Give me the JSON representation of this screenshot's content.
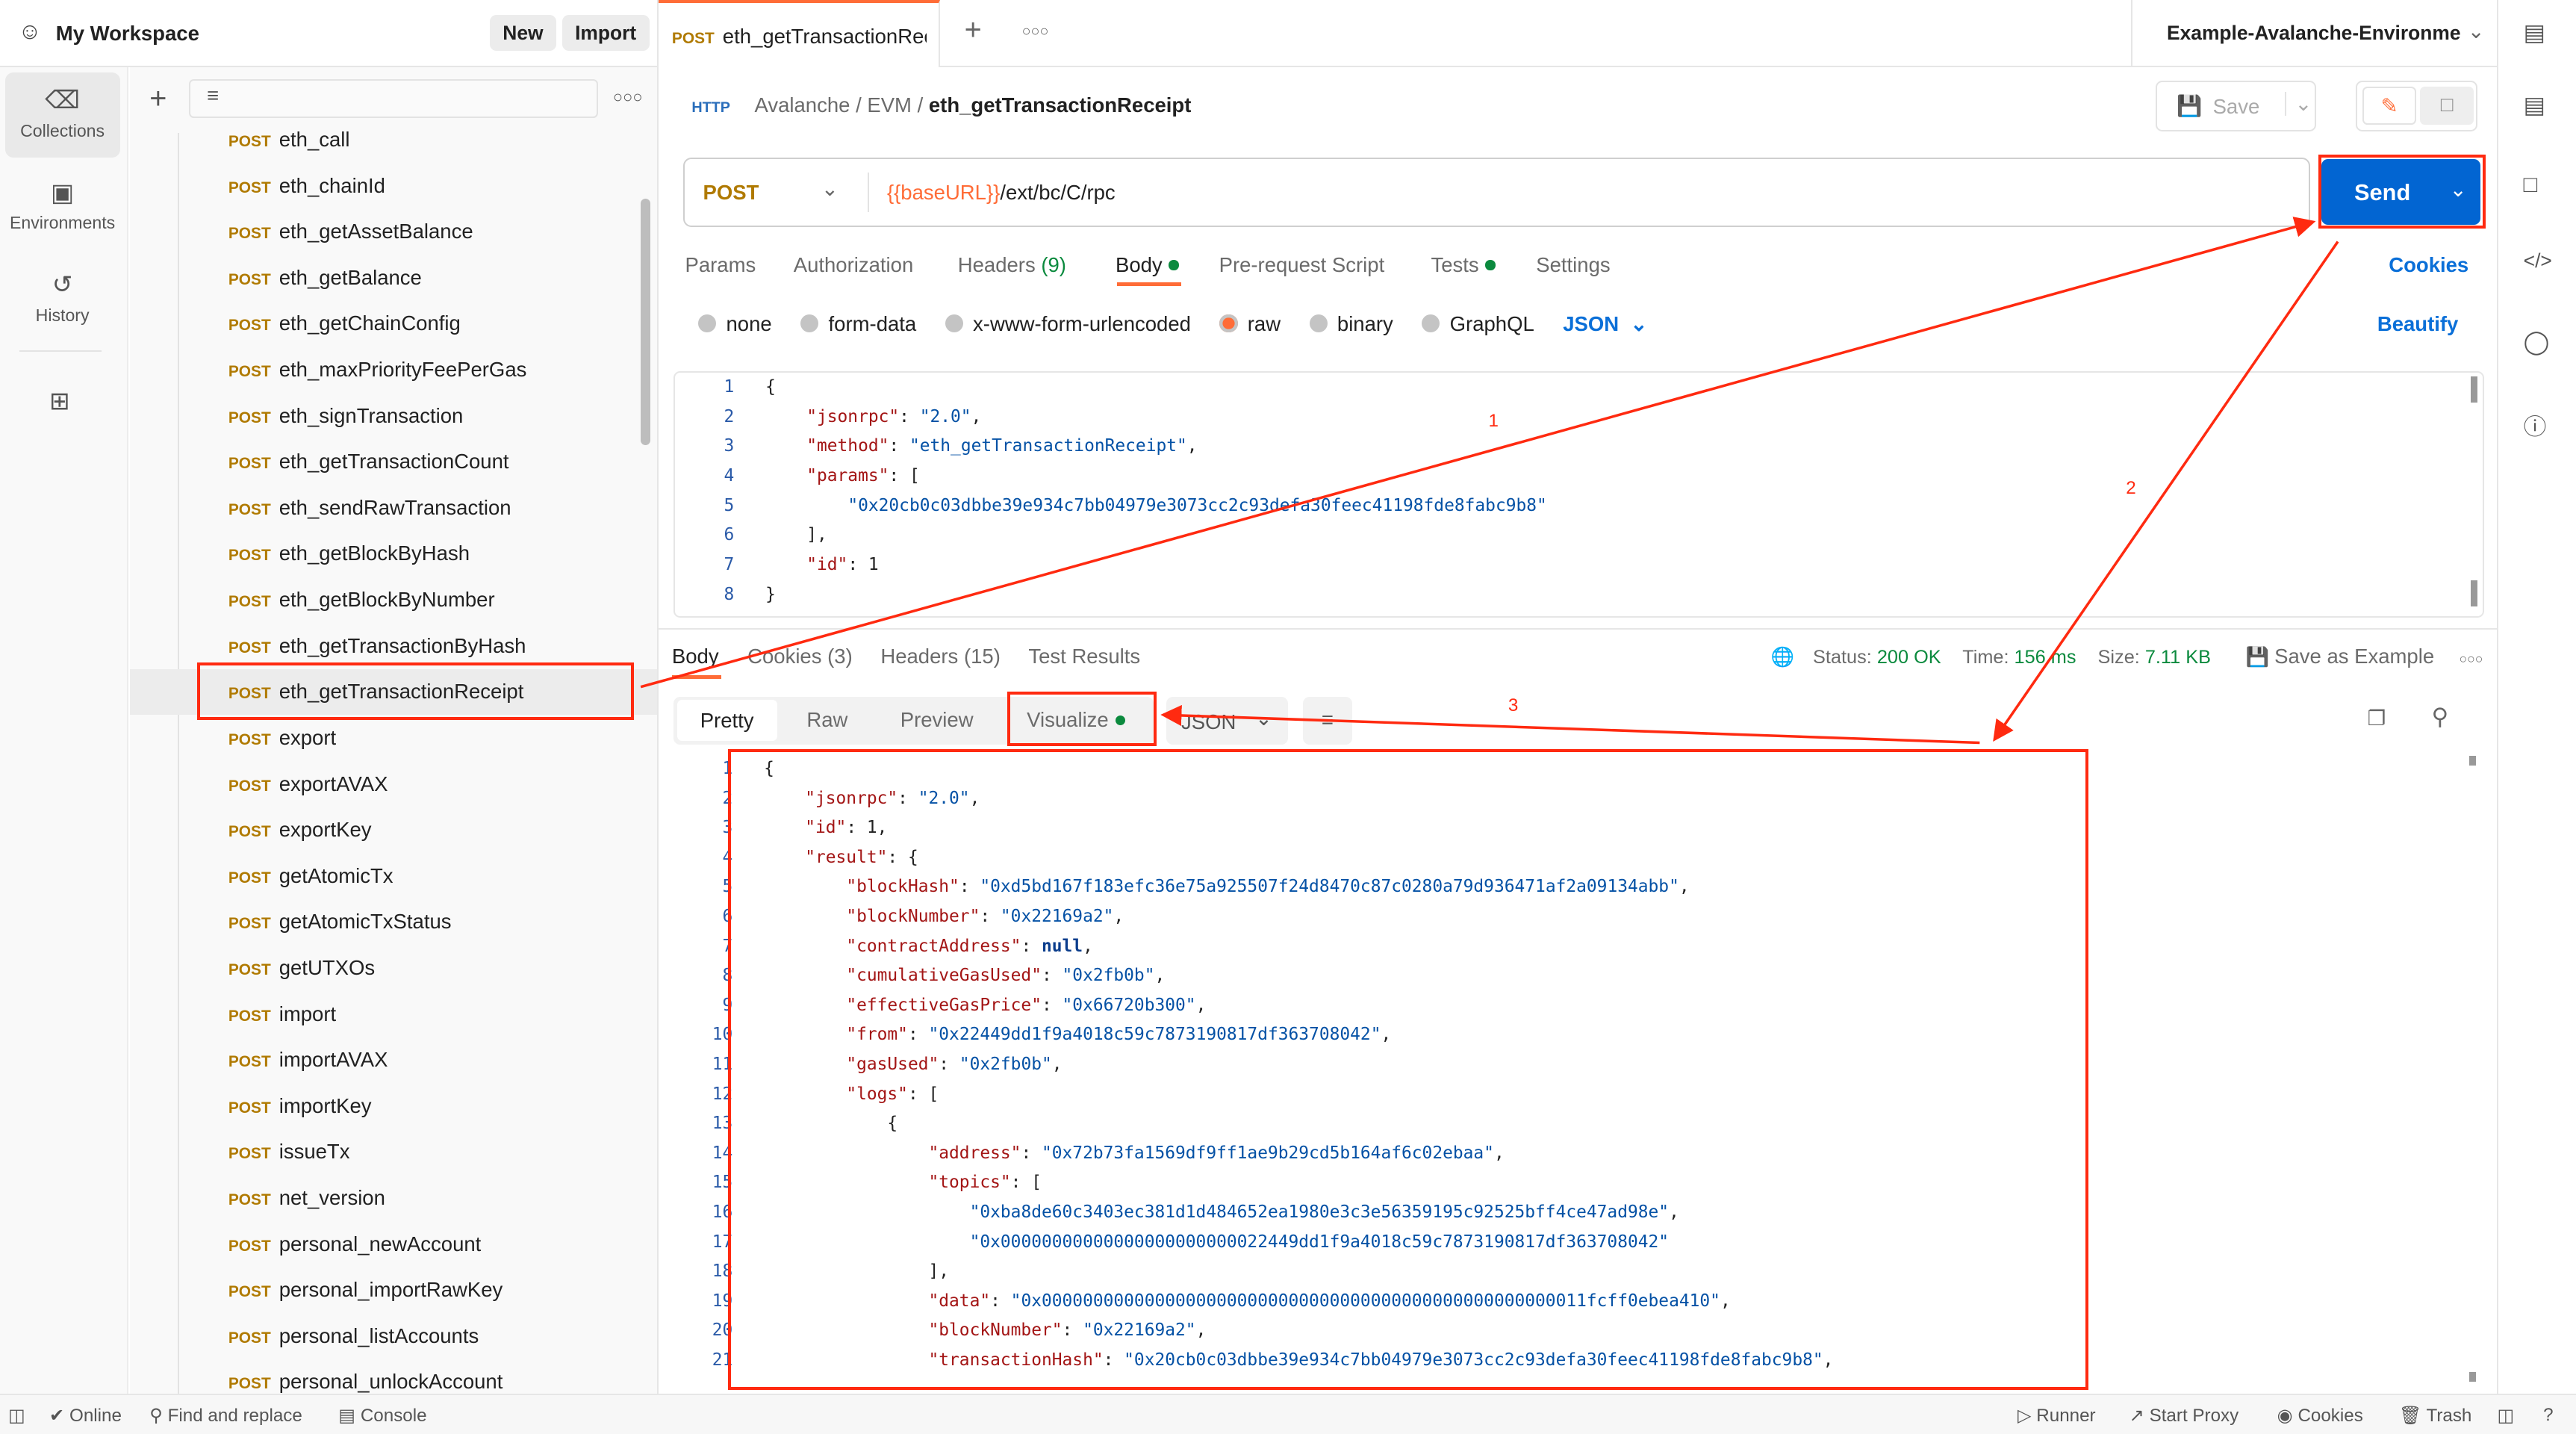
{
  "workspace": {
    "title": "My Workspace",
    "new_label": "New",
    "import_label": "Import"
  },
  "nav": [
    {
      "label": "Collections",
      "icon": "trash-can-icon"
    },
    {
      "label": "Environments",
      "icon": "environment-icon"
    },
    {
      "label": "History",
      "icon": "history-icon"
    }
  ],
  "collection": {
    "method": "POST",
    "items": [
      "eth_call",
      "eth_chainId",
      "eth_getAssetBalance",
      "eth_getBalance",
      "eth_getChainConfig",
      "eth_maxPriorityFeePerGas",
      "eth_signTransaction",
      "eth_getTransactionCount",
      "eth_sendRawTransaction",
      "eth_getBlockByHash",
      "eth_getBlockByNumber",
      "eth_getTransactionByHash",
      "eth_getTransactionReceipt",
      "export",
      "exportAVAX",
      "exportKey",
      "getAtomicTx",
      "getAtomicTxStatus",
      "getUTXOs",
      "import",
      "importAVAX",
      "importKey",
      "issueTx",
      "net_version",
      "personal_newAccount",
      "personal_importRawKey",
      "personal_listAccounts",
      "personal_unlockAccount"
    ],
    "selected_index": 12
  },
  "tab": {
    "method": "POST",
    "title": "eth_getTransactionRece"
  },
  "environment": "Example-Avalanche-Environme",
  "breadcrumb": {
    "icon_label": "HTTP",
    "parts": [
      "Avalanche",
      "EVM"
    ],
    "current": "eth_getTransactionReceipt",
    "save_label": "Save"
  },
  "request": {
    "method": "POST",
    "url_var": "{{baseURL}}",
    "url_path": "/ext/bc/C/rpc",
    "send_label": "Send",
    "tabs": [
      "Params",
      "Authorization",
      "Headers",
      "Body",
      "Pre-request Script",
      "Tests",
      "Settings"
    ],
    "headers_count": "(9)",
    "cookies_label": "Cookies",
    "body_types": [
      "none",
      "form-data",
      "x-www-form-urlencoded",
      "raw",
      "binary",
      "GraphQL"
    ],
    "body_format": "JSON",
    "beautify_label": "Beautify",
    "body_lines": [
      "{",
      "    \"jsonrpc\": \"2.0\",",
      "    \"method\": \"eth_getTransactionReceipt\",",
      "    \"params\": [",
      "        \"0x20cb0c03dbbe39e934c7bb04979e3073cc2c93defa30feec41198fde8fabc9b8\"",
      "    ],",
      "    \"id\": 1",
      "}"
    ]
  },
  "response": {
    "tabs": [
      "Body",
      "Cookies (3)",
      "Headers (15)",
      "Test Results"
    ],
    "status_label": "Status:",
    "status": "200 OK",
    "time_label": "Time:",
    "time": "156 ms",
    "size_label": "Size:",
    "size": "7.11 KB",
    "save_example": "Save as Example",
    "views": [
      "Pretty",
      "Raw",
      "Preview",
      "Visualize"
    ],
    "format": "JSON",
    "body_lines": [
      "{",
      "    \"jsonrpc\": \"2.0\",",
      "    \"id\": 1,",
      "    \"result\": {",
      "        \"blockHash\": \"0xd5bd167f183efc36e75a925507f24d8470c87c0280a79d936471af2a09134abb\",",
      "        \"blockNumber\": \"0x22169a2\",",
      "        \"contractAddress\": null,",
      "        \"cumulativeGasUsed\": \"0x2fb0b\",",
      "        \"effectiveGasPrice\": \"0x66720b300\",",
      "        \"from\": \"0x22449dd1f9a4018c59c7873190817df363708042\",",
      "        \"gasUsed\": \"0x2fb0b\",",
      "        \"logs\": [",
      "            {",
      "                \"address\": \"0x72b73fa1569df9ff1ae9b29cd5b164af6c02ebaa\",",
      "                \"topics\": [",
      "                    \"0xba8de60c3403ec381d1d484652ea1980e3c3e56359195c92525bff4ce47ad98e\",",
      "                    \"0x00000000000000000000000022449dd1f9a4018c59c7873190817df363708042\"",
      "                ],",
      "                \"data\": \"0x00000000000000000000000000000000000000000000000000011fcff0ebea410\",",
      "                \"blockNumber\": \"0x22169a2\",",
      "                \"transactionHash\": \"0x20cb0c03dbbe39e934c7bb04979e3073cc2c93defa30feec41198fde8fabc9b8\","
    ]
  },
  "status_bar": {
    "left": [
      "Online",
      "Find and replace",
      "Console"
    ],
    "right": [
      "Runner",
      "Start Proxy",
      "Cookies",
      "Trash"
    ]
  },
  "annotations": {
    "labels": [
      "1",
      "2",
      "3"
    ],
    "color": "#ff2a10"
  },
  "colors": {
    "accent": "#ff6c37",
    "send": "#0265d2",
    "post": "#b07a00",
    "link": "#0a6fd8",
    "success": "#0b8a3e"
  }
}
